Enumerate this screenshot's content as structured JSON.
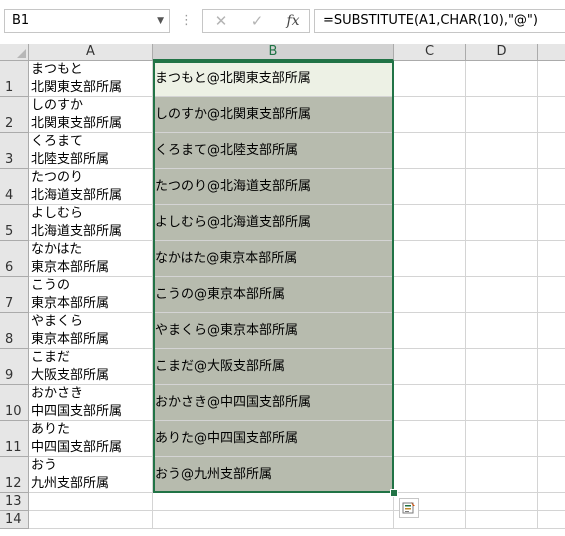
{
  "formula_bar": {
    "name_box": "B1",
    "formula": "=SUBSTITUTE(A1,CHAR(10),\"@\")",
    "cancel_icon": "x-icon",
    "enter_icon": "check-icon",
    "function_icon": "fx-icon"
  },
  "columns": [
    "A",
    "B",
    "C",
    "D"
  ],
  "rows": [
    {
      "num": "1",
      "a1": "まつもと",
      "a2": "北関東支部所属",
      "b": "まつもと@北関東支部所属"
    },
    {
      "num": "2",
      "a1": "しのすか",
      "a2": "北関東支部所属",
      "b": "しのすか@北関東支部所属"
    },
    {
      "num": "3",
      "a1": "くろまて",
      "a2": "北陸支部所属",
      "b": "くろまて@北陸支部所属"
    },
    {
      "num": "4",
      "a1": "たつのり",
      "a2": "北海道支部所属",
      "b": "たつのり@北海道支部所属"
    },
    {
      "num": "5",
      "a1": "よしむら",
      "a2": "北海道支部所属",
      "b": "よしむら@北海道支部所属"
    },
    {
      "num": "6",
      "a1": "なかはた",
      "a2": "東京本部所属",
      "b": "なかはた@東京本部所属"
    },
    {
      "num": "7",
      "a1": "こうの",
      "a2": "東京本部所属",
      "b": "こうの@東京本部所属"
    },
    {
      "num": "8",
      "a1": "やまくら",
      "a2": "東京本部所属",
      "b": "やまくら@東京本部所属"
    },
    {
      "num": "9",
      "a1": "こまだ",
      "a2": "大阪支部所属",
      "b": "こまだ@大阪支部所属"
    },
    {
      "num": "10",
      "a1": "おかさき",
      "a2": "中四国支部所属",
      "b": "おかさき@中四国支部所属"
    },
    {
      "num": "11",
      "a1": "ありた",
      "a2": "中四国支部所属",
      "b": "ありた@中四国支部所属"
    },
    {
      "num": "12",
      "a1": "おう",
      "a2": "九州支部所属",
      "b": "おう@九州支部所属"
    }
  ],
  "extra_rows": [
    "13",
    "14"
  ],
  "colors": {
    "accent": "#217346",
    "selection": "#b7bbae",
    "active_cell": "#edf1e5"
  }
}
